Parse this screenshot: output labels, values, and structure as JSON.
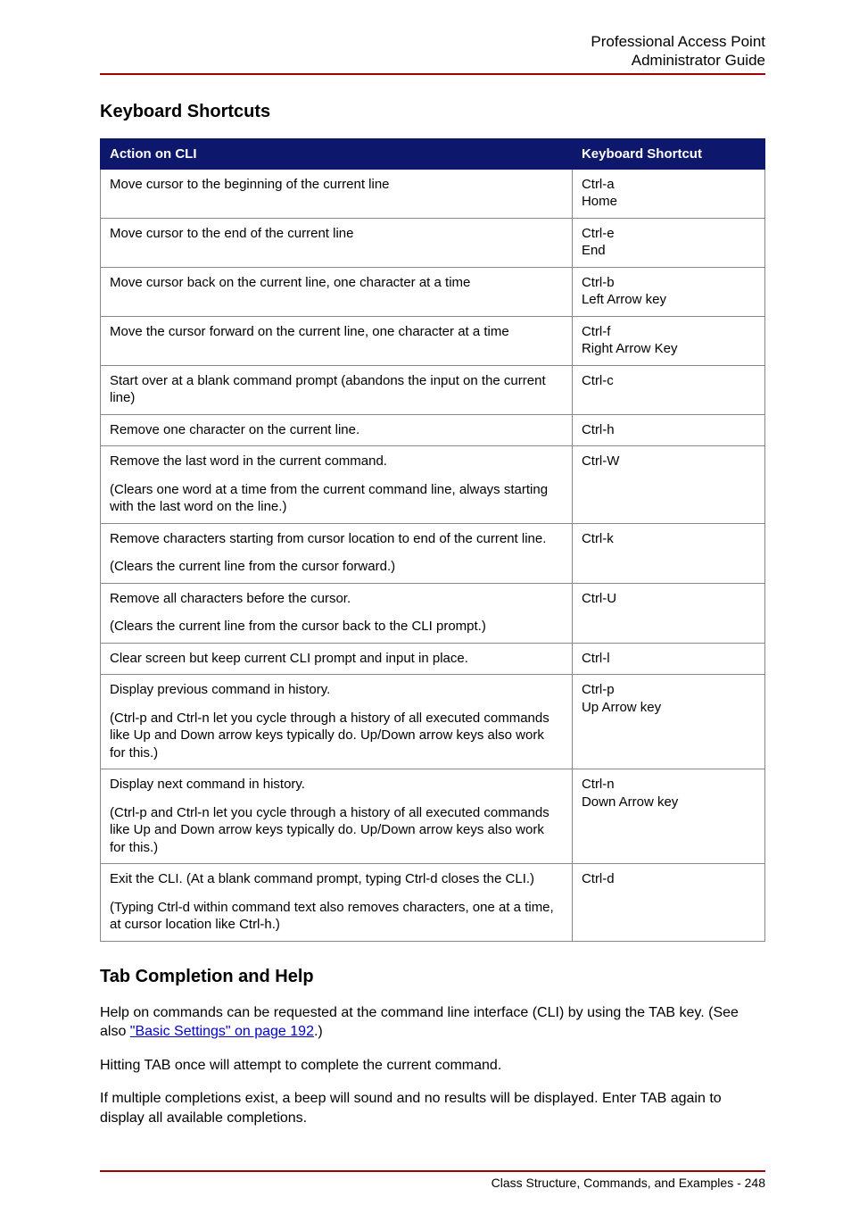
{
  "header": {
    "line1": "Professional Access Point",
    "line2": "Administrator Guide"
  },
  "section1": {
    "title": "Keyboard Shortcuts",
    "table": {
      "col1": "Action on CLI",
      "col2": "Keyboard Shortcut",
      "rows": [
        {
          "a": "Move cursor to the beginning of the current line",
          "s": "Ctrl-a\nHome"
        },
        {
          "a": "Move cursor to the end of the current line",
          "s": "Ctrl-e\nEnd"
        },
        {
          "a": "Move cursor back on the current line, one character at a time",
          "s": "Ctrl-b\nLeft Arrow key"
        },
        {
          "a": "Move the cursor forward on the current line, one character at a time",
          "s": "Ctrl-f\nRight Arrow Key"
        },
        {
          "a": "Start over at a blank command prompt (abandons the input on the current line)",
          "s": "Ctrl-c"
        },
        {
          "a": "Remove one character on the current line.",
          "s": "Ctrl-h"
        },
        {
          "a": "Remove the last word in the current command.",
          "sub": "(Clears one word at a time from the current command line, always starting with the last word on the line.)",
          "s": "Ctrl-W"
        },
        {
          "a": "Remove characters starting from cursor location to end of the current line.",
          "sub": "(Clears the current line from the cursor forward.)",
          "s": "Ctrl-k"
        },
        {
          "a": "Remove all characters before the cursor.",
          "sub": "(Clears the current line from the cursor back to the CLI prompt.)",
          "s": "Ctrl-U"
        },
        {
          "a": "Clear screen but keep current CLI prompt and input in place.",
          "s": "Ctrl-l"
        },
        {
          "a": "Display previous command in history.",
          "sub": "(Ctrl-p and Ctrl-n let you cycle through a history of all executed commands like Up and Down arrow keys typically do. Up/Down arrow keys also work for this.)",
          "s": "Ctrl-p\nUp Arrow key"
        },
        {
          "a": "Display next command in history.",
          "sub": "(Ctrl-p and Ctrl-n let you cycle through a history of all executed commands like Up and Down arrow keys typically do. Up/Down arrow keys also work for this.)",
          "s": "Ctrl-n\nDown Arrow key"
        },
        {
          "a": "Exit the CLI. (At a blank command prompt, typing Ctrl-d closes the CLI.)",
          "sub": "(Typing Ctrl-d within command text also removes characters, one at a time, at cursor location like Ctrl-h.)",
          "s": "Ctrl-d"
        }
      ]
    }
  },
  "section2": {
    "title": "Tab Completion and Help",
    "p1_a": "Help on commands can be requested at the command line interface (CLI) by using the TAB key. (See also ",
    "p1_link": "\"Basic Settings\" on page 192",
    "p1_b": ".)",
    "p2": "Hitting TAB once will attempt to complete the current command.",
    "p3": "If multiple completions exist, a beep will sound and no results will be displayed. Enter TAB again to display all available completions."
  },
  "footer": {
    "text": "Class Structure, Commands, and Examples - 248"
  }
}
